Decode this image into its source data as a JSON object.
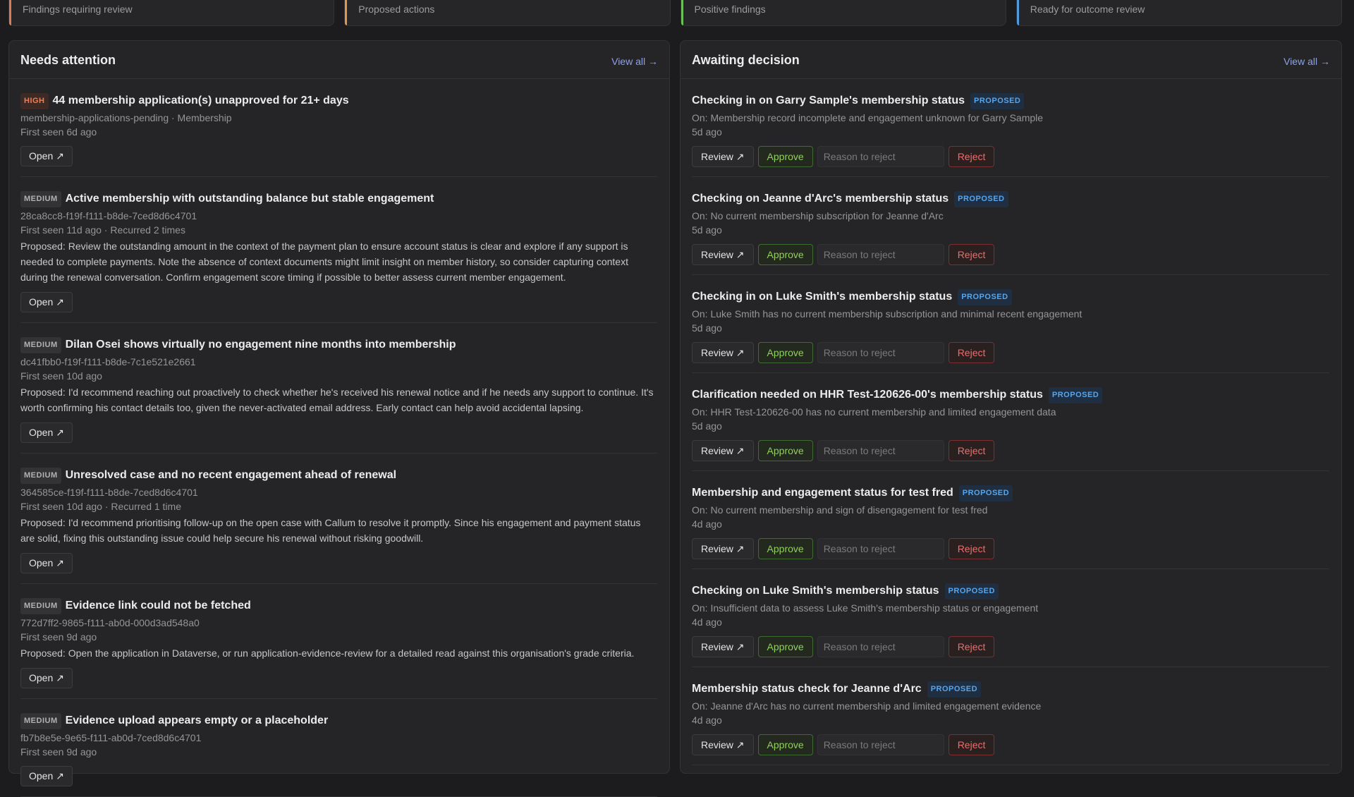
{
  "stats": [
    {
      "label": "Findings requiring review",
      "color": "#e07a56"
    },
    {
      "label": "Proposed actions",
      "color": "#e2954c"
    },
    {
      "label": "Positive findings",
      "color": "#6cbf59"
    },
    {
      "label": "Ready for outcome review",
      "color": "#4e9be0"
    }
  ],
  "needs_attention": {
    "title": "Needs attention",
    "view_all": "View all →",
    "open_label": "Open ↗",
    "items": [
      {
        "severity": "HIGH",
        "title": "44 membership application(s) unapproved for 21+ days",
        "meta1": "membership-applications-pending · Membership",
        "meta2": "First seen 6d ago",
        "proposed": ""
      },
      {
        "severity": "MEDIUM",
        "title": "Active membership with outstanding balance but stable engagement",
        "meta1": "28ca8cc8-f19f-f111-b8de-7ced8d6c4701",
        "meta2": "First seen 11d ago · Recurred 2 times",
        "proposed": "Proposed: Review the outstanding amount in the context of the payment plan to ensure account status is clear and explore if any support is needed to complete payments. Note the absence of context documents might limit insight on member history, so consider capturing context during the renewal conversation. Confirm engagement score timing if possible to better assess current member engagement."
      },
      {
        "severity": "MEDIUM",
        "title": "Dilan Osei shows virtually no engagement nine months into membership",
        "meta1": "dc41fbb0-f19f-f111-b8de-7c1e521e2661",
        "meta2": "First seen 10d ago",
        "proposed": "Proposed: I'd recommend reaching out proactively to check whether he's received his renewal notice and if he needs any support to continue. It's worth confirming his contact details too, given the never-activated email address. Early contact can help avoid accidental lapsing."
      },
      {
        "severity": "MEDIUM",
        "title": "Unresolved case and no recent engagement ahead of renewal",
        "meta1": "364585ce-f19f-f111-b8de-7ced8d6c4701",
        "meta2": "First seen 10d ago · Recurred 1 time",
        "proposed": "Proposed: I'd recommend prioritising follow-up on the open case with Callum to resolve it promptly. Since his engagement and payment status are solid, fixing this outstanding issue could help secure his renewal without risking goodwill."
      },
      {
        "severity": "MEDIUM",
        "title": "Evidence link could not be fetched",
        "meta1": "772d7ff2-9865-f111-ab0d-000d3ad548a0",
        "meta2": "First seen 9d ago",
        "proposed": "Proposed: Open the application in Dataverse, or run application-evidence-review for a detailed read against this organisation's grade criteria."
      },
      {
        "severity": "MEDIUM",
        "title": "Evidence upload appears empty or a placeholder",
        "meta1": "fb7b8e5e-9e65-f111-ab0d-7ced8d6c4701",
        "meta2": "First seen 9d ago",
        "proposed": ""
      }
    ]
  },
  "awaiting": {
    "title": "Awaiting decision",
    "view_all": "View all →",
    "badge": "PROPOSED",
    "review_label": "Review ↗",
    "approve_label": "Approve",
    "reject_label": "Reject",
    "reason_placeholder": "Reason to reject",
    "items": [
      {
        "title": "Checking in on Garry Sample's membership status",
        "on": "On: Membership record incomplete and engagement unknown for Garry Sample",
        "ago": "5d ago"
      },
      {
        "title": "Checking on Jeanne d'Arc's membership status",
        "on": "On: No current membership subscription for Jeanne d'Arc",
        "ago": "5d ago"
      },
      {
        "title": "Checking in on Luke Smith's membership status",
        "on": "On: Luke Smith has no current membership subscription and minimal recent engagement",
        "ago": "5d ago"
      },
      {
        "title": "Clarification needed on HHR Test-120626-00's membership status",
        "on": "On: HHR Test-120626-00 has no current membership and limited engagement data",
        "ago": "5d ago"
      },
      {
        "title": "Membership and engagement status for test fred",
        "on": "On: No current membership and sign of disengagement for test fred",
        "ago": "4d ago"
      },
      {
        "title": "Checking on Luke Smith's membership status",
        "on": "On: Insufficient data to assess Luke Smith's membership status or engagement",
        "ago": "4d ago"
      },
      {
        "title": "Membership status check for Jeanne d'Arc",
        "on": "On: Jeanne d'Arc has no current membership and limited engagement evidence",
        "ago": "4d ago"
      }
    ]
  }
}
